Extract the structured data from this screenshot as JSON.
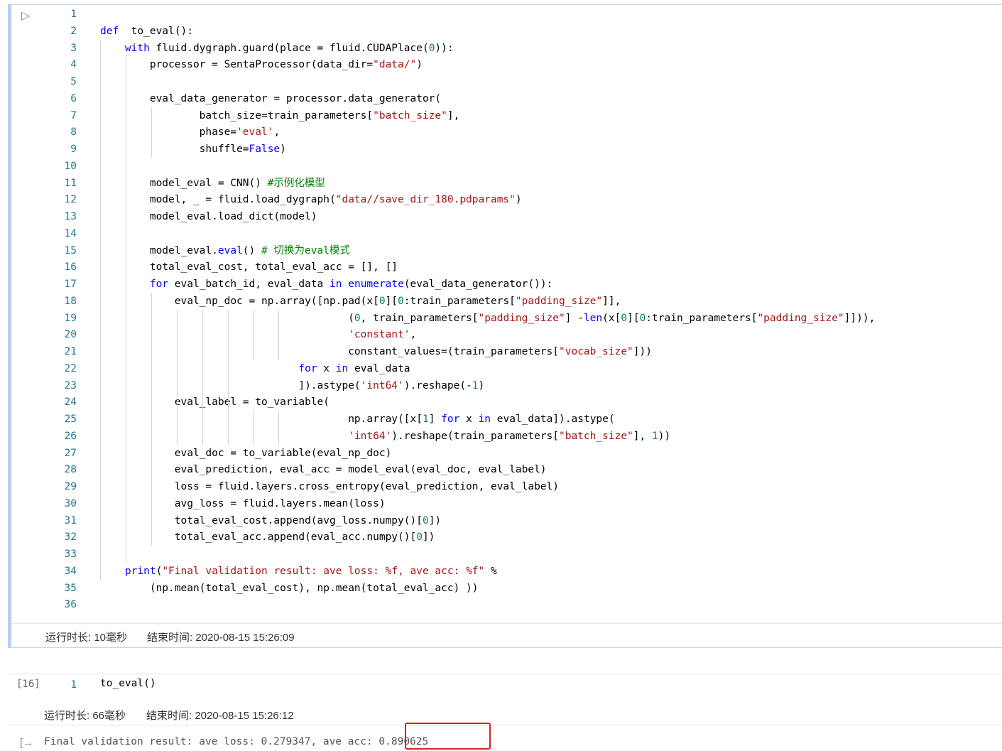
{
  "cell1": {
    "lines": [
      [],
      [
        [
          "kw",
          "def"
        ],
        [
          "",
          "  to_eval():"
        ]
      ],
      [
        [
          "",
          "    "
        ],
        [
          "kw",
          "with"
        ],
        [
          "",
          " fluid.dygraph.guard(place = fluid.CUDAPlace("
        ],
        [
          "num",
          "0"
        ],
        [
          "",
          "))"
        ],
        [
          "",
          ":"
        ]
      ],
      [
        [
          "",
          "        processor = SentaProcessor(data_dir="
        ],
        [
          "str",
          "\"data/\""
        ],
        [
          "",
          ")"
        ]
      ],
      [],
      [
        [
          "",
          "        eval_data_generator = processor.data_generator("
        ]
      ],
      [
        [
          "",
          "                batch_size=train_parameters["
        ],
        [
          "str",
          "\"batch_size\""
        ],
        [
          "",
          "],"
        ]
      ],
      [
        [
          "",
          "                phase="
        ],
        [
          "str",
          "'eval'"
        ],
        [
          "",
          ","
        ]
      ],
      [
        [
          "",
          "                shuffle="
        ],
        [
          "kw",
          "False"
        ],
        [
          "",
          ")"
        ]
      ],
      [],
      [
        [
          "",
          "        model_eval = CNN() "
        ],
        [
          "cm",
          "#示例化模型"
        ]
      ],
      [
        [
          "",
          "        model, _ = fluid.load_dygraph("
        ],
        [
          "str",
          "\"data//save_dir_180.pdparams\""
        ],
        [
          "",
          ")"
        ]
      ],
      [
        [
          "",
          "        model_eval.load_dict(model)"
        ]
      ],
      [],
      [
        [
          "",
          "        model_eval."
        ],
        [
          "kw",
          "eval"
        ],
        [
          "",
          "() "
        ],
        [
          "cm",
          "# 切换为eval模式"
        ]
      ],
      [
        [
          "",
          "        total_eval_cost, total_eval_acc = [], []"
        ]
      ],
      [
        [
          "",
          "        "
        ],
        [
          "kw",
          "for"
        ],
        [
          "",
          " eval_batch_id, eval_data "
        ],
        [
          "kw",
          "in"
        ],
        [
          "",
          ""
        ],
        [
          "kw",
          " enumerate"
        ],
        [
          "",
          "(eval_data_generator()):"
        ]
      ],
      [
        [
          "",
          "            eval_np_doc = np.array([np.pad(x["
        ],
        [
          "num",
          "0"
        ],
        [
          "",
          "]["
        ],
        [
          "num",
          "0"
        ],
        [
          "",
          ":train_parameters["
        ],
        [
          "str",
          "\"padding_size\""
        ],
        [
          "",
          "]],"
        ]
      ],
      [
        [
          "",
          "                                        ("
        ],
        [
          "num",
          "0"
        ],
        [
          "",
          ", train_parameters["
        ],
        [
          "str",
          "\"padding_size\""
        ],
        [
          "",
          "] -"
        ],
        [
          "kw",
          "len"
        ],
        [
          "",
          "(x["
        ],
        [
          "num",
          "0"
        ],
        [
          "",
          "]["
        ],
        [
          "num",
          "0"
        ],
        [
          "",
          ":train_parameters["
        ],
        [
          "str",
          "\"padding_size\""
        ],
        [
          "",
          "]])),"
        ]
      ],
      [
        [
          "",
          "                                        "
        ],
        [
          "str",
          "'constant'"
        ],
        [
          "",
          ","
        ]
      ],
      [
        [
          "",
          "                                        constant_values=(train_parameters["
        ],
        [
          "str",
          "\"vocab_size\""
        ],
        [
          "",
          "]))"
        ]
      ],
      [
        [
          "",
          "                                "
        ],
        [
          "kw",
          "for"
        ],
        [
          "",
          " x "
        ],
        [
          "kw",
          "in"
        ],
        [
          "",
          " eval_data"
        ]
      ],
      [
        [
          "",
          "                                ]).astype("
        ],
        [
          "str",
          "'int64'"
        ],
        [
          "",
          ").reshape(-"
        ],
        [
          "num",
          "1"
        ],
        [
          "",
          ")"
        ]
      ],
      [
        [
          "",
          "            eval_label = to_variable("
        ]
      ],
      [
        [
          "",
          "                                        np.array([x["
        ],
        [
          "num",
          "1"
        ],
        [
          "",
          "] "
        ],
        [
          "kw",
          "for"
        ],
        [
          "",
          " x "
        ],
        [
          "kw",
          "in"
        ],
        [
          "",
          " eval_data]).astype("
        ]
      ],
      [
        [
          "",
          "                                        "
        ],
        [
          "str",
          "'int64'"
        ],
        [
          "",
          ").reshape(train_parameters["
        ],
        [
          "str",
          "\"batch_size\""
        ],
        [
          "",
          "], "
        ],
        [
          "num",
          "1"
        ],
        [
          "",
          "))"
        ]
      ],
      [
        [
          "",
          "            eval_doc = to_variable(eval_np_doc)"
        ]
      ],
      [
        [
          "",
          "            eval_prediction, eval_acc = model_eval(eval_doc, eval_label)"
        ]
      ],
      [
        [
          "",
          "            loss = fluid.layers.cross_entropy(eval_prediction, eval_label)"
        ]
      ],
      [
        [
          "",
          "            avg_loss = fluid.layers.mean(loss)"
        ]
      ],
      [
        [
          "",
          "            total_eval_cost.append(avg_loss.numpy()["
        ],
        [
          "num",
          "0"
        ],
        [
          "",
          "])"
        ]
      ],
      [
        [
          "",
          "            total_eval_acc.append(eval_acc.numpy()["
        ],
        [
          "num",
          "0"
        ],
        [
          "",
          "])"
        ]
      ],
      [],
      [
        [
          "",
          "    "
        ],
        [
          "kw",
          "print"
        ],
        [
          "",
          "("
        ],
        [
          "str",
          "\"Final validation result: ave loss: %f, ave acc: %f\""
        ],
        [
          "",
          " %"
        ]
      ],
      [
        [
          "",
          "        (np.mean(total_eval_cost), np.mean(total_eval_acc) ))"
        ]
      ],
      []
    ],
    "runtime": "运行时长: 10毫秒",
    "endtime": "结束时间: 2020-08-15 15:26:09"
  },
  "cell2": {
    "prompt": "[16]",
    "line_no": "1",
    "code": "to_eval()",
    "runtime": "运行时长: 66毫秒",
    "endtime": "结束时间: 2020-08-15 15:26:12",
    "output": "Final validation result: ave loss: 0.279347, ave acc: 0.890625"
  },
  "icons": {
    "run": "run-triangle-icon",
    "output": "output-arrow-icon"
  }
}
